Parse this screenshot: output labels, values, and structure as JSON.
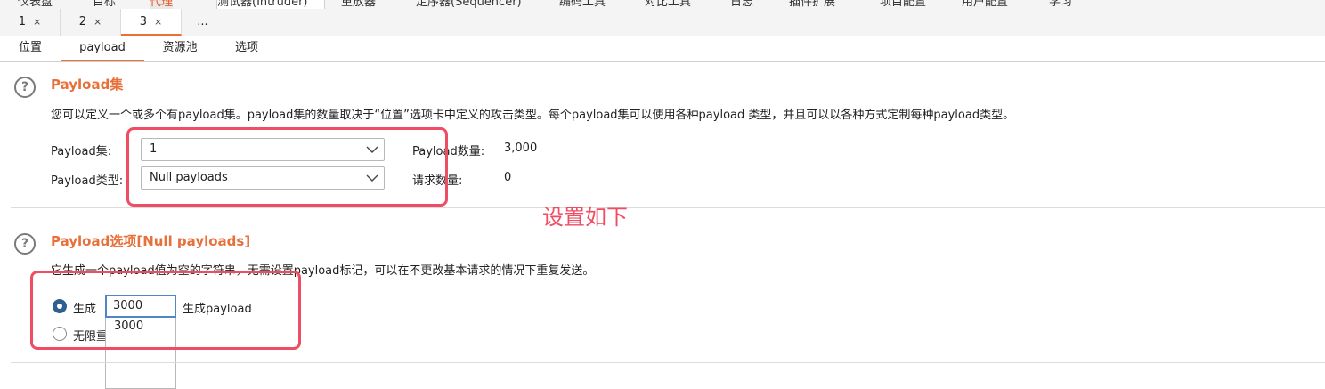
{
  "top_tabs": [
    "仪表盘",
    "目标",
    "代理",
    "测试器(Intruder)",
    "重放器",
    "定序器(Sequencer)",
    "编码工具",
    "对比工具",
    "日志",
    "插件扩展",
    "项目配置",
    "用户配置",
    "学习"
  ],
  "attack_tabs": [
    {
      "label": "1",
      "close": "×"
    },
    {
      "label": "2",
      "close": "×"
    },
    {
      "label": "3",
      "close": "×"
    },
    {
      "label": "...",
      "close": ""
    }
  ],
  "sub_tabs": [
    "位置",
    "payload",
    "资源池",
    "选项"
  ],
  "help_icon_glyph": "?",
  "payload_sets": {
    "title": "Payload集",
    "description": "您可以定义一个或多个有payload集。payload集的数量取决于“位置”选项卡中定义的攻击类型。每个payload集可以使用各种payload 类型，并且可以以各种方式定制每种payload类型。",
    "set_label": "Payload集:",
    "set_value": "1",
    "type_label": "Payload类型:",
    "type_value": "Null payloads",
    "count_label": "Payload数量:",
    "count_value": "3,000",
    "request_label": "请求数量:",
    "request_value": "0"
  },
  "annotation": "设置如下",
  "payload_options": {
    "title": "Payload选项[Null payloads]",
    "description": "它生成一个payload值为空的字符串，无需设置payload标记，可以在不更改基本请求的情况下重复发送。",
    "generate_label": "生成",
    "generate_value": "3000",
    "generate_suffix": "生成payload",
    "dropdown_option": "3000",
    "infinite_label": "无限重"
  },
  "colors": {
    "accent": "#e8703a",
    "annotation": "#ee4d63",
    "radio": "#2e5f8e"
  }
}
